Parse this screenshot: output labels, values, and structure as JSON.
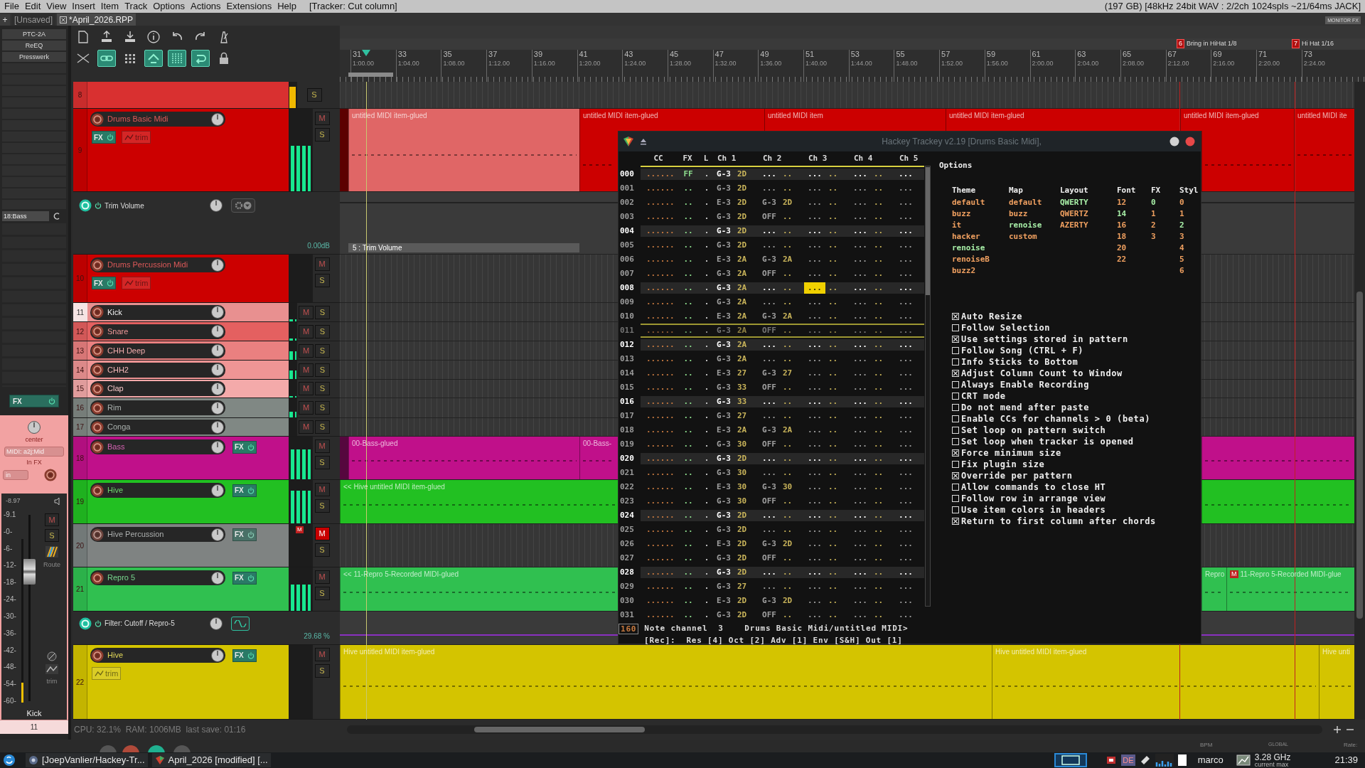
{
  "menu_bar": {
    "items": [
      "File",
      "Edit",
      "View",
      "Insert",
      "Item",
      "Track",
      "Options",
      "Actions",
      "Extensions",
      "Help"
    ],
    "last_action": "[Tracker: Cut column]",
    "status": "(197 GB) [48kHz 24bit WAV : 2/2ch 1024spls ~21/64ms JACK]"
  },
  "project_tabs": {
    "add_label": "+",
    "tabs": [
      {
        "label": "[Unsaved]",
        "selected": false
      },
      {
        "label": "*April_2026.RPP",
        "selected": true
      }
    ],
    "monitor_fx": "MONITOR FX"
  },
  "mixer_strip": {
    "fx_slots": [
      "PTC-2A",
      "ReEQ",
      "Presswerk"
    ],
    "input_slot": "18:Bass",
    "fx_label": "FX",
    "pan_label": "center",
    "midi_input": "MIDI: a2j:Mid",
    "input_fx": "In FX",
    "input_mode": "in",
    "peak": "-8.97",
    "scale": [
      "-9.1",
      "-0-",
      "-6-",
      "-12-",
      "-18-",
      "-24-",
      "-30-",
      "-36-",
      "-42-",
      "-48-",
      "-54-",
      "-60-"
    ],
    "mute_label": "M",
    "solo_label": "S",
    "route_label": "Route",
    "trim_label": "trim",
    "track_name": "Kick",
    "track_number": "11",
    "level": 0.12
  },
  "toolbar": {
    "row_1": [
      {
        "on": false
      },
      {
        "on": false
      },
      {
        "on": false
      },
      {
        "on": false
      },
      {
        "on": false
      },
      {
        "on": false
      },
      {
        "on": false
      }
    ],
    "row_2": [
      {
        "on": false
      },
      {
        "on": true
      },
      {
        "on": false
      },
      {
        "on": true
      },
      {
        "on": true
      },
      {
        "on": true
      },
      {
        "on": false
      }
    ]
  },
  "ruler": {
    "markers": [
      {
        "number": "6",
        "label": "Bring in HiHat 1/8"
      },
      {
        "number": "7",
        "label": "Hi Hat 1/16"
      }
    ],
    "bars": [
      {
        "bar": "31",
        "time": "1:00.00"
      },
      {
        "bar": "33",
        "time": "1:04.00"
      },
      {
        "bar": "35",
        "time": "1:08.00"
      },
      {
        "bar": "37",
        "time": "1:12.00"
      },
      {
        "bar": "39",
        "time": "1:16.00"
      },
      {
        "bar": "41",
        "time": "1:20.00"
      },
      {
        "bar": "43",
        "time": "1:24.00"
      },
      {
        "bar": "45",
        "time": "1:28.00"
      },
      {
        "bar": "47",
        "time": "1:32.00"
      },
      {
        "bar": "49",
        "time": "1:36.00"
      },
      {
        "bar": "51",
        "time": "1:40.00"
      },
      {
        "bar": "53",
        "time": "1:44.00"
      },
      {
        "bar": "55",
        "time": "1:48.00"
      },
      {
        "bar": "57",
        "time": "1:52.00"
      },
      {
        "bar": "59",
        "time": "1:56.00"
      },
      {
        "bar": "61",
        "time": "2:00.00"
      },
      {
        "bar": "63",
        "time": "2:04.00"
      },
      {
        "bar": "65",
        "time": "2:08.00"
      },
      {
        "bar": "67",
        "time": "2:12.00"
      },
      {
        "bar": "69",
        "time": "2:16.00"
      },
      {
        "bar": "71",
        "time": "2:20.00"
      },
      {
        "bar": "73",
        "time": "2:24.00"
      }
    ]
  },
  "tracks": [
    {
      "kind": "track",
      "number": "8",
      "color": "#d93030",
      "selected": false,
      "solo_label": "S",
      "level": 0.8
    },
    {
      "kind": "track",
      "number": "9",
      "name": "Drums Basic Midi",
      "color": "#cc0000",
      "selected": false,
      "muted": false,
      "fx_label": "FX",
      "trim_label": "trim",
      "mute_label": "M",
      "solo_label": "S",
      "level": 0.55,
      "items": [
        {
          "label": "untitled MIDI item-glued",
          "selected": true
        },
        {
          "label": "untitled MIDI item-glued",
          "selected": false
        },
        {
          "label": "untitled MIDI item",
          "selected": false
        },
        {
          "label": "untitled MIDI item-glued",
          "selected": false
        },
        {
          "label": "untitled MIDI item-glued",
          "selected": false
        },
        {
          "label": "untitled MIDI ite",
          "selected": false
        }
      ]
    },
    {
      "kind": "envelope",
      "name": "Trim Volume",
      "value": "0.00dB",
      "lane_label": "5 : Trim Volume"
    },
    {
      "kind": "track",
      "number": "10",
      "name": "Drums Percussion Midi",
      "color": "#cc0000",
      "selected": false,
      "muted": false,
      "fx_label": "FX",
      "trim_label": "trim",
      "mute_label": "M",
      "solo_label": "S"
    },
    {
      "kind": "track",
      "number": "11",
      "name": "Kick",
      "color": "#e89090",
      "selected": true,
      "muted": false,
      "mute_label": "M",
      "solo_label": "S",
      "level": 0.1
    },
    {
      "kind": "track",
      "number": "12",
      "name": "Snare",
      "color": "#e46060",
      "selected": false,
      "muted": false,
      "mute_label": "M",
      "solo_label": "S",
      "level": 0.1
    },
    {
      "kind": "track",
      "number": "13",
      "name": "CHH Deep",
      "color": "#ea8080",
      "selected": false,
      "muted": false,
      "mute_label": "M",
      "solo_label": "S",
      "level": 0.45
    },
    {
      "kind": "track",
      "number": "14",
      "name": "CHH2",
      "color": "#ef9595",
      "selected": false,
      "muted": false,
      "mute_label": "M",
      "solo_label": "S",
      "level": 0.45
    },
    {
      "kind": "track",
      "number": "15",
      "name": "Clap",
      "color": "#f4aaaa",
      "selected": false,
      "muted": false,
      "mute_label": "M",
      "solo_label": "S",
      "level": 0.1
    },
    {
      "kind": "track",
      "number": "16",
      "name": "Rim",
      "color": "#808884",
      "selected": false,
      "muted": false,
      "mute_label": "M",
      "solo_label": "S",
      "level": 0.3
    },
    {
      "kind": "track",
      "number": "17",
      "name": "Conga",
      "color": "#808884",
      "selected": false,
      "muted": false,
      "mute_label": "M",
      "solo_label": "S"
    },
    {
      "kind": "track",
      "number": "18",
      "name": "Bass",
      "color": "#c0108a",
      "selected": false,
      "muted": false,
      "fx_label": "FX",
      "mute_label": "M",
      "solo_label": "S",
      "level": 0.7,
      "items": [
        {
          "label": "00-Bass-glued",
          "selected": false
        },
        {
          "label": "00-Bass-",
          "selected": false
        }
      ]
    },
    {
      "kind": "track",
      "number": "19",
      "name": "Hive",
      "color": "#22c022",
      "selected": false,
      "muted": false,
      "fx_label": "FX",
      "mute_label": "M",
      "solo_label": "S",
      "level": 0.75,
      "items": [
        {
          "label": "<< Hive untitled MIDI item-glued",
          "selected": false
        }
      ]
    },
    {
      "kind": "track",
      "number": "20",
      "name": "Hive Percussion",
      "color": "#7c8482",
      "selected": false,
      "muted": true,
      "fx_label": "FX",
      "mute_label": "M",
      "solo_label": "S",
      "mute_badge": "M"
    },
    {
      "kind": "track",
      "number": "21",
      "name": "Repro 5",
      "color": "#30c050",
      "selected": false,
      "muted": false,
      "fx_label": "FX",
      "mute_label": "M",
      "solo_label": "S",
      "level": 0.6,
      "items": [
        {
          "label": "<< 11-Repro 5-Recorded MIDI-glued",
          "selected": false
        },
        {
          "label": "Repro",
          "selected": false
        },
        {
          "label": "11-Repro 5-Recorded MIDI-glue",
          "badge": "M",
          "selected": false
        }
      ]
    },
    {
      "kind": "envelope",
      "name": "Filter: Cutoff / Repro-5",
      "value": "29.68 %"
    },
    {
      "kind": "track",
      "number": "22",
      "name": "Hive",
      "color": "#d4c400",
      "selected": false,
      "muted": false,
      "fx_label": "FX",
      "trim_label": "trim",
      "mute_label": "M",
      "solo_label": "S",
      "items": [
        {
          "label": "Hive untitled MIDI item-glued",
          "selected": false
        },
        {
          "label": "Hive untitled MIDI item-glued",
          "selected": false
        },
        {
          "label": "Hive unti",
          "selected": false
        }
      ]
    }
  ],
  "tracker_window": {
    "title": "Hackey Trackey v2.19 [Drums Basic Midi],",
    "columns": [
      "CC",
      "FX",
      "L",
      "Ch 1",
      "Ch 2",
      "Ch 3",
      "Ch 4",
      "Ch 5"
    ],
    "rows": [
      {
        "num": "000",
        "highlighted": true,
        "marked": false,
        "cc": "......",
        "fx": "FF",
        "l": ".",
        "channels": [
          {
            "note": "G-3",
            "vel": "2D",
            "selected": false
          },
          {
            "note": "...",
            "vel": "..",
            "selected": false
          },
          {
            "note": "...",
            "vel": "..",
            "selected": false
          },
          {
            "note": "...",
            "vel": "..",
            "selected": false
          },
          {
            "note": "...",
            "selected": false
          }
        ]
      },
      {
        "num": "001",
        "highlighted": false,
        "marked": false,
        "cc": "......",
        "fx": "..",
        "l": ".",
        "channels": [
          {
            "note": "G-3",
            "vel": "2D",
            "selected": false
          },
          {
            "note": "...",
            "vel": "..",
            "selected": false
          },
          {
            "note": "...",
            "vel": "..",
            "selected": false
          },
          {
            "note": "...",
            "vel": "..",
            "selected": false
          },
          {
            "note": "...",
            "selected": false
          }
        ]
      },
      {
        "num": "002",
        "highlighted": false,
        "marked": false,
        "cc": "......",
        "fx": "..",
        "l": ".",
        "channels": [
          {
            "note": "E-3",
            "vel": "2D",
            "selected": false
          },
          {
            "note": "G-3",
            "vel": "2D",
            "selected": false
          },
          {
            "note": "...",
            "vel": "..",
            "selected": false
          },
          {
            "note": "...",
            "vel": "..",
            "selected": false
          },
          {
            "note": "...",
            "selected": false
          }
        ]
      },
      {
        "num": "003",
        "highlighted": false,
        "marked": false,
        "cc": "......",
        "fx": "..",
        "l": ".",
        "channels": [
          {
            "note": "G-3",
            "vel": "2D",
            "selected": false
          },
          {
            "note": "OFF",
            "vel": "..",
            "selected": false
          },
          {
            "note": "...",
            "vel": "..",
            "selected": false
          },
          {
            "note": "...",
            "vel": "..",
            "selected": false
          },
          {
            "note": "...",
            "selected": false
          }
        ]
      },
      {
        "num": "004",
        "highlighted": true,
        "marked": false,
        "cc": "......",
        "fx": "..",
        "l": ".",
        "channels": [
          {
            "note": "G-3",
            "vel": "2D",
            "selected": false
          },
          {
            "note": "...",
            "vel": "..",
            "selected": false
          },
          {
            "note": "...",
            "vel": "..",
            "selected": false
          },
          {
            "note": "...",
            "vel": "..",
            "selected": false
          },
          {
            "note": "...",
            "selected": false
          }
        ]
      },
      {
        "num": "005",
        "highlighted": false,
        "marked": false,
        "cc": "......",
        "fx": "..",
        "l": ".",
        "channels": [
          {
            "note": "G-3",
            "vel": "2D",
            "selected": false
          },
          {
            "note": "...",
            "vel": "..",
            "selected": false
          },
          {
            "note": "...",
            "vel": "..",
            "selected": false
          },
          {
            "note": "...",
            "vel": "..",
            "selected": false
          },
          {
            "note": "...",
            "selected": false
          }
        ]
      },
      {
        "num": "006",
        "highlighted": false,
        "marked": false,
        "cc": "......",
        "fx": "..",
        "l": ".",
        "channels": [
          {
            "note": "E-3",
            "vel": "2A",
            "selected": false
          },
          {
            "note": "G-3",
            "vel": "2A",
            "selected": false
          },
          {
            "note": "...",
            "vel": "..",
            "selected": false
          },
          {
            "note": "...",
            "vel": "..",
            "selected": false
          },
          {
            "note": "...",
            "selected": false
          }
        ]
      },
      {
        "num": "007",
        "highlighted": false,
        "marked": false,
        "cc": "......",
        "fx": "..",
        "l": ".",
        "channels": [
          {
            "note": "G-3",
            "vel": "2A",
            "selected": false
          },
          {
            "note": "OFF",
            "vel": "..",
            "selected": false
          },
          {
            "note": "...",
            "vel": "..",
            "selected": false
          },
          {
            "note": "...",
            "vel": "..",
            "selected": false
          },
          {
            "note": "...",
            "selected": false
          }
        ]
      },
      {
        "num": "008",
        "highlighted": true,
        "marked": false,
        "cc": "......",
        "fx": "..",
        "l": ".",
        "channels": [
          {
            "note": "G-3",
            "vel": "2A",
            "selected": false
          },
          {
            "note": "...",
            "vel": "..",
            "selected": false
          },
          {
            "note": "...",
            "vel": "..",
            "selected": true
          },
          {
            "note": "...",
            "vel": "..",
            "selected": false
          },
          {
            "note": "...",
            "selected": false
          }
        ]
      },
      {
        "num": "009",
        "highlighted": false,
        "marked": false,
        "cc": "......",
        "fx": "..",
        "l": ".",
        "channels": [
          {
            "note": "G-3",
            "vel": "2A",
            "selected": false
          },
          {
            "note": "...",
            "vel": "..",
            "selected": false
          },
          {
            "note": "...",
            "vel": "..",
            "selected": false
          },
          {
            "note": "...",
            "vel": "..",
            "selected": false
          },
          {
            "note": "...",
            "selected": false
          }
        ]
      },
      {
        "num": "010",
        "highlighted": false,
        "marked": false,
        "cc": "......",
        "fx": "..",
        "l": ".",
        "channels": [
          {
            "note": "E-3",
            "vel": "2A",
            "selected": false
          },
          {
            "note": "G-3",
            "vel": "2A",
            "selected": false
          },
          {
            "note": "...",
            "vel": "..",
            "selected": false
          },
          {
            "note": "...",
            "vel": "..",
            "selected": false
          },
          {
            "note": "...",
            "selected": false
          }
        ]
      },
      {
        "num": "011",
        "highlighted": false,
        "marked": true,
        "cc": "......",
        "fx": "..",
        "l": ".",
        "channels": [
          {
            "note": "G-3",
            "vel": "2A",
            "selected": false
          },
          {
            "note": "OFF",
            "vel": "..",
            "selected": false
          },
          {
            "note": "...",
            "vel": "..",
            "selected": false
          },
          {
            "note": "...",
            "vel": "..",
            "selected": false
          },
          {
            "note": "...",
            "selected": false
          }
        ]
      },
      {
        "num": "012",
        "highlighted": true,
        "marked": false,
        "cc": "......",
        "fx": "..",
        "l": ".",
        "channels": [
          {
            "note": "G-3",
            "vel": "2A",
            "selected": false
          },
          {
            "note": "...",
            "vel": "..",
            "selected": false
          },
          {
            "note": "...",
            "vel": "..",
            "selected": false
          },
          {
            "note": "...",
            "vel": "..",
            "selected": false
          },
          {
            "note": "...",
            "selected": false
          }
        ]
      },
      {
        "num": "013",
        "highlighted": false,
        "marked": false,
        "cc": "......",
        "fx": "..",
        "l": ".",
        "channels": [
          {
            "note": "G-3",
            "vel": "2A",
            "selected": false
          },
          {
            "note": "...",
            "vel": "..",
            "selected": false
          },
          {
            "note": "...",
            "vel": "..",
            "selected": false
          },
          {
            "note": "...",
            "vel": "..",
            "selected": false
          },
          {
            "note": "...",
            "selected": false
          }
        ]
      },
      {
        "num": "014",
        "highlighted": false,
        "marked": false,
        "cc": "......",
        "fx": "..",
        "l": ".",
        "channels": [
          {
            "note": "E-3",
            "vel": "27",
            "selected": false
          },
          {
            "note": "G-3",
            "vel": "27",
            "selected": false
          },
          {
            "note": "...",
            "vel": "..",
            "selected": false
          },
          {
            "note": "...",
            "vel": "..",
            "selected": false
          },
          {
            "note": "...",
            "selected": false
          }
        ]
      },
      {
        "num": "015",
        "highlighted": false,
        "marked": false,
        "cc": "......",
        "fx": "..",
        "l": ".",
        "channels": [
          {
            "note": "G-3",
            "vel": "33",
            "selected": false
          },
          {
            "note": "OFF",
            "vel": "..",
            "selected": false
          },
          {
            "note": "...",
            "vel": "..",
            "selected": false
          },
          {
            "note": "...",
            "vel": "..",
            "selected": false
          },
          {
            "note": "...",
            "selected": false
          }
        ]
      },
      {
        "num": "016",
        "highlighted": true,
        "marked": false,
        "cc": "......",
        "fx": "..",
        "l": ".",
        "channels": [
          {
            "note": "G-3",
            "vel": "33",
            "selected": false
          },
          {
            "note": "...",
            "vel": "..",
            "selected": false
          },
          {
            "note": "...",
            "vel": "..",
            "selected": false
          },
          {
            "note": "...",
            "vel": "..",
            "selected": false
          },
          {
            "note": "...",
            "selected": false
          }
        ]
      },
      {
        "num": "017",
        "highlighted": false,
        "marked": false,
        "cc": "......",
        "fx": "..",
        "l": ".",
        "channels": [
          {
            "note": "G-3",
            "vel": "27",
            "selected": false
          },
          {
            "note": "...",
            "vel": "..",
            "selected": false
          },
          {
            "note": "...",
            "vel": "..",
            "selected": false
          },
          {
            "note": "...",
            "vel": "..",
            "selected": false
          },
          {
            "note": "...",
            "selected": false
          }
        ]
      },
      {
        "num": "018",
        "highlighted": false,
        "marked": false,
        "cc": "......",
        "fx": "..",
        "l": ".",
        "channels": [
          {
            "note": "E-3",
            "vel": "2A",
            "selected": false
          },
          {
            "note": "G-3",
            "vel": "2A",
            "selected": false
          },
          {
            "note": "...",
            "vel": "..",
            "selected": false
          },
          {
            "note": "...",
            "vel": "..",
            "selected": false
          },
          {
            "note": "...",
            "selected": false
          }
        ]
      },
      {
        "num": "019",
        "highlighted": false,
        "marked": false,
        "cc": "......",
        "fx": "..",
        "l": ".",
        "channels": [
          {
            "note": "G-3",
            "vel": "30",
            "selected": false
          },
          {
            "note": "OFF",
            "vel": "..",
            "selected": false
          },
          {
            "note": "...",
            "vel": "..",
            "selected": false
          },
          {
            "note": "...",
            "vel": "..",
            "selected": false
          },
          {
            "note": "...",
            "selected": false
          }
        ]
      },
      {
        "num": "020",
        "highlighted": true,
        "marked": false,
        "cc": "......",
        "fx": "..",
        "l": ".",
        "channels": [
          {
            "note": "G-3",
            "vel": "2D",
            "selected": false
          },
          {
            "note": "...",
            "vel": "..",
            "selected": false
          },
          {
            "note": "...",
            "vel": "..",
            "selected": false
          },
          {
            "note": "...",
            "vel": "..",
            "selected": false
          },
          {
            "note": "...",
            "selected": false
          }
        ]
      },
      {
        "num": "021",
        "highlighted": false,
        "marked": false,
        "cc": "......",
        "fx": "..",
        "l": ".",
        "channels": [
          {
            "note": "G-3",
            "vel": "30",
            "selected": false
          },
          {
            "note": "...",
            "vel": "..",
            "selected": false
          },
          {
            "note": "...",
            "vel": "..",
            "selected": false
          },
          {
            "note": "...",
            "vel": "..",
            "selected": false
          },
          {
            "note": "...",
            "selected": false
          }
        ]
      },
      {
        "num": "022",
        "highlighted": false,
        "marked": false,
        "cc": "......",
        "fx": "..",
        "l": ".",
        "channels": [
          {
            "note": "E-3",
            "vel": "30",
            "selected": false
          },
          {
            "note": "G-3",
            "vel": "30",
            "selected": false
          },
          {
            "note": "...",
            "vel": "..",
            "selected": false
          },
          {
            "note": "...",
            "vel": "..",
            "selected": false
          },
          {
            "note": "...",
            "selected": false
          }
        ]
      },
      {
        "num": "023",
        "highlighted": false,
        "marked": false,
        "cc": "......",
        "fx": "..",
        "l": ".",
        "channels": [
          {
            "note": "G-3",
            "vel": "30",
            "selected": false
          },
          {
            "note": "OFF",
            "vel": "..",
            "selected": false
          },
          {
            "note": "...",
            "vel": "..",
            "selected": false
          },
          {
            "note": "...",
            "vel": "..",
            "selected": false
          },
          {
            "note": "...",
            "selected": false
          }
        ]
      },
      {
        "num": "024",
        "highlighted": true,
        "marked": false,
        "cc": "......",
        "fx": "..",
        "l": ".",
        "channels": [
          {
            "note": "G-3",
            "vel": "2D",
            "selected": false
          },
          {
            "note": "...",
            "vel": "..",
            "selected": false
          },
          {
            "note": "...",
            "vel": "..",
            "selected": false
          },
          {
            "note": "...",
            "vel": "..",
            "selected": false
          },
          {
            "note": "...",
            "selected": false
          }
        ]
      },
      {
        "num": "025",
        "highlighted": false,
        "marked": false,
        "cc": "......",
        "fx": "..",
        "l": ".",
        "channels": [
          {
            "note": "G-3",
            "vel": "2D",
            "selected": false
          },
          {
            "note": "...",
            "vel": "..",
            "selected": false
          },
          {
            "note": "...",
            "vel": "..",
            "selected": false
          },
          {
            "note": "...",
            "vel": "..",
            "selected": false
          },
          {
            "note": "...",
            "selected": false
          }
        ]
      },
      {
        "num": "026",
        "highlighted": false,
        "marked": false,
        "cc": "......",
        "fx": "..",
        "l": ".",
        "channels": [
          {
            "note": "E-3",
            "vel": "2D",
            "selected": false
          },
          {
            "note": "G-3",
            "vel": "2D",
            "selected": false
          },
          {
            "note": "...",
            "vel": "..",
            "selected": false
          },
          {
            "note": "...",
            "vel": "..",
            "selected": false
          },
          {
            "note": "...",
            "selected": false
          }
        ]
      },
      {
        "num": "027",
        "highlighted": false,
        "marked": false,
        "cc": "......",
        "fx": "..",
        "l": ".",
        "channels": [
          {
            "note": "G-3",
            "vel": "2D",
            "selected": false
          },
          {
            "note": "OFF",
            "vel": "..",
            "selected": false
          },
          {
            "note": "...",
            "vel": "..",
            "selected": false
          },
          {
            "note": "...",
            "vel": "..",
            "selected": false
          },
          {
            "note": "...",
            "selected": false
          }
        ]
      },
      {
        "num": "028",
        "highlighted": true,
        "marked": false,
        "cc": "......",
        "fx": "..",
        "l": ".",
        "channels": [
          {
            "note": "G-3",
            "vel": "2D",
            "selected": false
          },
          {
            "note": "...",
            "vel": "..",
            "selected": false
          },
          {
            "note": "...",
            "vel": "..",
            "selected": false
          },
          {
            "note": "...",
            "vel": "..",
            "selected": false
          },
          {
            "note": "...",
            "selected": false
          }
        ]
      },
      {
        "num": "029",
        "highlighted": false,
        "marked": false,
        "cc": "......",
        "fx": "..",
        "l": ".",
        "channels": [
          {
            "note": "G-3",
            "vel": "27",
            "selected": false
          },
          {
            "note": "...",
            "vel": "..",
            "selected": false
          },
          {
            "note": "...",
            "vel": "..",
            "selected": false
          },
          {
            "note": "...",
            "vel": "..",
            "selected": false
          },
          {
            "note": "...",
            "selected": false
          }
        ]
      },
      {
        "num": "030",
        "highlighted": false,
        "marked": false,
        "cc": "......",
        "fx": "..",
        "l": ".",
        "channels": [
          {
            "note": "E-3",
            "vel": "2D",
            "selected": false
          },
          {
            "note": "G-3",
            "vel": "2D",
            "selected": false
          },
          {
            "note": "...",
            "vel": "..",
            "selected": false
          },
          {
            "note": "...",
            "vel": "..",
            "selected": false
          },
          {
            "note": "...",
            "selected": false
          }
        ]
      },
      {
        "num": "031",
        "highlighted": false,
        "marked": false,
        "cc": "......",
        "fx": "..",
        "l": ".",
        "channels": [
          {
            "note": "G-3",
            "vel": "2D",
            "selected": false
          },
          {
            "note": "OFF",
            "vel": "..",
            "selected": false
          },
          {
            "note": "...",
            "vel": "..",
            "selected": false
          },
          {
            "note": "...",
            "vel": "..",
            "selected": false
          },
          {
            "note": "...",
            "selected": false
          }
        ]
      }
    ],
    "status": {
      "pattern_length": "160",
      "line_1": "Note channel  3    Drums Basic Midi/untitled MIDI>",
      "line_2": "[Rec]:  Res [4] Oct [2] Adv [1] Env [S&H] Out [1]"
    },
    "options": {
      "title": "Options",
      "columns": [
        {
          "header": "Theme",
          "options": [
            {
              "label": "default",
              "selected": false
            },
            {
              "label": "buzz",
              "selected": false
            },
            {
              "label": "it",
              "selected": false
            },
            {
              "label": "hacker",
              "selected": false
            },
            {
              "label": "renoise",
              "selected": true
            },
            {
              "label": "renoiseB",
              "selected": false
            },
            {
              "label": "buzz2",
              "selected": false
            }
          ]
        },
        {
          "header": "Map",
          "options": [
            {
              "label": "default",
              "selected": false
            },
            {
              "label": "buzz",
              "selected": false
            },
            {
              "label": "renoise",
              "selected": true
            },
            {
              "label": "custom",
              "selected": false
            }
          ]
        },
        {
          "header": "Layout",
          "options": [
            {
              "label": "QWERTY",
              "selected": true
            },
            {
              "label": "QWERTZ",
              "selected": false
            },
            {
              "label": "AZERTY",
              "selected": false
            }
          ]
        },
        {
          "header": "Font",
          "options": [
            {
              "label": "12",
              "selected": false
            },
            {
              "label": "14",
              "selected": true
            },
            {
              "label": "16",
              "selected": false
            },
            {
              "label": "18",
              "selected": false
            },
            {
              "label": "20",
              "selected": false
            },
            {
              "label": "22",
              "selected": false
            }
          ]
        },
        {
          "header": "FX",
          "options": [
            {
              "label": "0",
              "selected": true
            },
            {
              "label": "1",
              "selected": false
            },
            {
              "label": "2",
              "selected": false
            },
            {
              "label": "3",
              "selected": false
            }
          ]
        },
        {
          "header": "Styl",
          "options": [
            {
              "label": "0",
              "selected": false
            },
            {
              "label": "1",
              "selected": false
            },
            {
              "label": "2",
              "selected": true
            },
            {
              "label": "3",
              "selected": false
            },
            {
              "label": "4",
              "selected": false
            },
            {
              "label": "5",
              "selected": false
            },
            {
              "label": "6",
              "selected": false
            }
          ]
        }
      ],
      "checkboxes": [
        {
          "label": "Auto Resize",
          "checked": true
        },
        {
          "label": "Follow Selection",
          "checked": false
        },
        {
          "label": "Use settings stored in pattern",
          "checked": true
        },
        {
          "label": "Follow Song (CTRL + F)",
          "checked": false
        },
        {
          "label": "Info Sticks to Bottom",
          "checked": false
        },
        {
          "label": "Adjust Column Count to Window",
          "checked": true
        },
        {
          "label": "Always Enable Recording",
          "checked": false
        },
        {
          "label": "CRT mode",
          "checked": false
        },
        {
          "label": "Do not mend after paste",
          "checked": false
        },
        {
          "label": "Enable CCs for channels > 0 (beta)",
          "checked": false
        },
        {
          "label": "Set loop on pattern switch",
          "checked": false
        },
        {
          "label": "Set loop when tracker is opened",
          "checked": false
        },
        {
          "label": "Force minimum size",
          "checked": true
        },
        {
          "label": "Fix plugin size",
          "checked": false
        },
        {
          "label": "Override per pattern",
          "checked": true
        },
        {
          "label": "Allow commands to close HT",
          "checked": false
        },
        {
          "label": "Follow row in arrange view",
          "checked": false
        },
        {
          "label": "Use item colors in headers",
          "checked": false
        },
        {
          "label": "Return to first column after chords",
          "checked": true
        }
      ]
    }
  },
  "status_bar": {
    "text": "CPU: 32.1%  RAM: 1006MB  last save: 01:16"
  },
  "transport": {
    "bpm_label": "BPM",
    "global_label": "GLOBAL",
    "rate_label": "Rate:"
  },
  "taskbar": {
    "windows": [
      {
        "label": "[JoepVanlier/Hackey-Tr...",
        "selected": false
      },
      {
        "label": "April_2026 [modified] [...",
        "selected": false
      }
    ],
    "keyboard_layout": "DE",
    "user": "marco",
    "cpu_frequency": "3.28 GHz",
    "cpu_governor": "current max",
    "clock": "21:39"
  }
}
